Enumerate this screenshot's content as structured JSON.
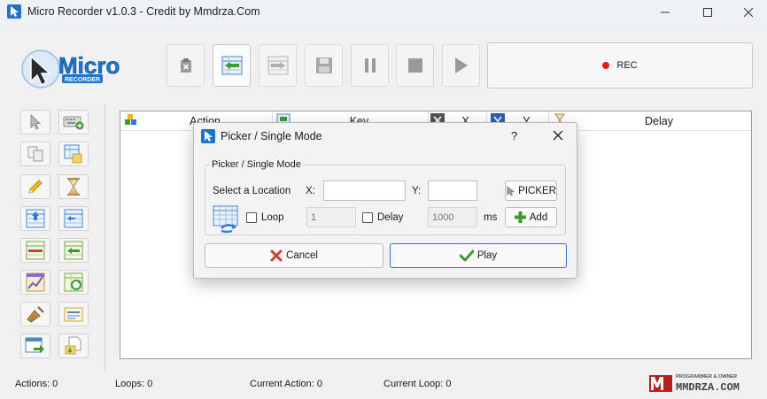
{
  "window": {
    "title": "Micro Recorder v1.0.3 - Credit by Mmdrza.Com"
  },
  "logo": {
    "word": "Micro",
    "sub": "RECORDER"
  },
  "toolbar": {
    "rec_label": "REC"
  },
  "grid": {
    "columns": [
      "Action",
      "Key",
      "X",
      "Y",
      "Delay"
    ]
  },
  "status": {
    "actions": "Actions: 0",
    "loops": "Loops: 0",
    "current_action": "Current Action: 0",
    "current_loop": "Current Loop: 0"
  },
  "brand": {
    "tagline": "PROGRAMMER & OWNER",
    "name": "MMDRZA.COM"
  },
  "dialog": {
    "title": "Picker / Single Mode",
    "help": "?",
    "group_title": "Picker / Single Mode",
    "location_label": "Select a Location",
    "x_label": "X:",
    "y_label": "Y:",
    "x_value": "",
    "y_value": "",
    "picker_label": "PICKER",
    "loop_label": "Loop",
    "loop_value": "1",
    "delay_label": "Delay",
    "delay_value": "1000",
    "ms_label": "ms",
    "add_label": "Add",
    "cancel_label": "Cancel",
    "play_label": "Play"
  },
  "colors": {
    "accent": "#2d6fce",
    "rec": "#e21b1b",
    "logo_blue": "#1e74c9"
  }
}
